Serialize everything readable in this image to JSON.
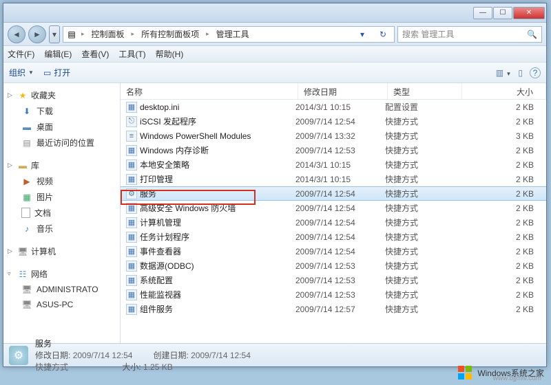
{
  "titlebar": {
    "min": "—",
    "max": "☐",
    "close": "✕"
  },
  "address": {
    "back": "◄",
    "fwd": "►",
    "drop": "▾",
    "root_icon": "▤",
    "crumbs": [
      "控制面板",
      "所有控制面板项",
      "管理工具"
    ],
    "sep": "▸",
    "refresh": "↻",
    "search_placeholder": "搜索 管理工具",
    "search_icon": "🔍"
  },
  "menu": {
    "file": "文件(F)",
    "edit": "编辑(E)",
    "view": "查看(V)",
    "tools": "工具(T)",
    "help": "帮助(H)"
  },
  "toolbar": {
    "organize": "组织",
    "open": "打开",
    "tri": "▼",
    "views_icon": "▥",
    "help_icon": "?"
  },
  "nav": {
    "favorites": {
      "label": "收藏夹",
      "exp": "▷",
      "items": [
        {
          "icon": "⬇",
          "label": "下载",
          "cls": "dl"
        },
        {
          "icon": "▬",
          "label": "桌面",
          "cls": "desk"
        },
        {
          "icon": "▤",
          "label": "最近访问的位置",
          "cls": "recent"
        }
      ]
    },
    "libraries": {
      "label": "库",
      "exp": "▷",
      "items": [
        {
          "icon": "▶",
          "label": "视频",
          "cls": "vid"
        },
        {
          "icon": "▦",
          "label": "图片",
          "cls": "pic"
        },
        {
          "icon": "",
          "label": "文档",
          "cls": "doc"
        },
        {
          "icon": "♪",
          "label": "音乐",
          "cls": "mus"
        }
      ]
    },
    "computer": {
      "label": "计算机",
      "exp": "▷"
    },
    "network": {
      "label": "网络",
      "exp": "▿",
      "items": [
        {
          "icon": "🖥",
          "label": "ADMINISTRATO",
          "cls": "pc"
        },
        {
          "icon": "🖥",
          "label": "ASUS-PC",
          "cls": "pc"
        }
      ]
    }
  },
  "columns": {
    "name": "名称",
    "date": "修改日期",
    "type": "类型",
    "size": "大小"
  },
  "rows": [
    {
      "icon": "▦",
      "name": "desktop.ini",
      "date": "2014/3/1 10:15",
      "type": "配置设置",
      "size": "2 KB"
    },
    {
      "icon": "⎋",
      "name": "iSCSI 发起程序",
      "date": "2009/7/14 12:54",
      "type": "快捷方式",
      "size": "2 KB"
    },
    {
      "icon": "≡",
      "name": "Windows PowerShell Modules",
      "date": "2009/7/14 13:32",
      "type": "快捷方式",
      "size": "3 KB"
    },
    {
      "icon": "▦",
      "name": "Windows 内存诊断",
      "date": "2009/7/14 12:53",
      "type": "快捷方式",
      "size": "2 KB"
    },
    {
      "icon": "▦",
      "name": "本地安全策略",
      "date": "2014/3/1 10:15",
      "type": "快捷方式",
      "size": "2 KB"
    },
    {
      "icon": "▦",
      "name": "打印管理",
      "date": "2014/3/1 10:15",
      "type": "快捷方式",
      "size": "2 KB"
    },
    {
      "icon": "⚙",
      "name": "服务",
      "date": "2009/7/14 12:54",
      "type": "快捷方式",
      "size": "2 KB",
      "selected": true
    },
    {
      "icon": "▦",
      "name": "高级安全 Windows 防火墙",
      "date": "2009/7/14 12:54",
      "type": "快捷方式",
      "size": "2 KB"
    },
    {
      "icon": "▦",
      "name": "计算机管理",
      "date": "2009/7/14 12:54",
      "type": "快捷方式",
      "size": "2 KB"
    },
    {
      "icon": "▦",
      "name": "任务计划程序",
      "date": "2009/7/14 12:54",
      "type": "快捷方式",
      "size": "2 KB"
    },
    {
      "icon": "▦",
      "name": "事件查看器",
      "date": "2009/7/14 12:54",
      "type": "快捷方式",
      "size": "2 KB"
    },
    {
      "icon": "▦",
      "name": "数据源(ODBC)",
      "date": "2009/7/14 12:53",
      "type": "快捷方式",
      "size": "2 KB"
    },
    {
      "icon": "▦",
      "name": "系统配置",
      "date": "2009/7/14 12:53",
      "type": "快捷方式",
      "size": "2 KB"
    },
    {
      "icon": "▦",
      "name": "性能监视器",
      "date": "2009/7/14 12:53",
      "type": "快捷方式",
      "size": "2 KB"
    },
    {
      "icon": "▦",
      "name": "组件服务",
      "date": "2009/7/14 12:57",
      "type": "快捷方式",
      "size": "2 KB"
    }
  ],
  "status": {
    "name": "服务",
    "mod_label": "修改日期:",
    "mod_val": "2009/7/14 12:54",
    "cre_label": "创建日期:",
    "cre_val": "2009/7/14 12:54",
    "type_label": "快捷方式",
    "size_label": "大小:",
    "size_val": "1.25 KB"
  },
  "watermark": {
    "text": "Windows系统之家",
    "sub": "www.bjjmlv.com"
  }
}
